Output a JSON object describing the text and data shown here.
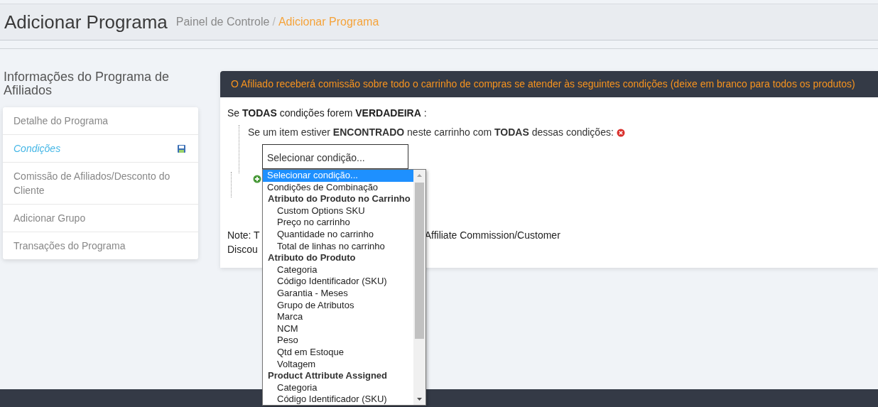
{
  "header": {
    "title": "Adicionar Programa",
    "breadcrumb_separator": "/",
    "breadcrumb": [
      {
        "label": "Painel de Controle",
        "selected": false
      },
      {
        "label": "Adicionar Programa",
        "selected": true
      }
    ]
  },
  "sidebar": {
    "title": "Informações do Programa de Afiliados",
    "items": [
      {
        "label": "Detalhe do Programa",
        "selected": false,
        "save_icon": false
      },
      {
        "label": "Condições",
        "selected": true,
        "save_icon": true
      },
      {
        "label": "Comissão de Afiliados/Desconto do Cliente",
        "selected": false,
        "save_icon": false
      },
      {
        "label": "Adicionar Grupo",
        "selected": false,
        "save_icon": false
      },
      {
        "label": "Transações do Programa",
        "selected": false,
        "save_icon": false
      }
    ]
  },
  "panel": {
    "heading": "O Afiliado receberá comissão sobre todo o carrinho de compras se atender às seguintes condições (deixe em branco para todos os produtos)",
    "rule": "Se **TODAS**  condições forem **VERDADEIRA** :",
    "subrule": "Se um item estiver **ENCONTRADO**  neste carrinho com **TODAS**  dessas condições:",
    "select": {
      "value": "Selecionar condição...",
      "options": [
        {
          "kind": "option",
          "label": "Selecionar condição...",
          "selected": true
        },
        {
          "kind": "option",
          "label": "Condições de Combinação",
          "selected": false
        },
        {
          "kind": "group",
          "label": "Atributo do Produto no Carrinho",
          "children": [
            {
              "kind": "option",
              "label": "Custom Options SKU",
              "selected": false
            },
            {
              "kind": "option",
              "label": "Preço no carrinho",
              "selected": false
            },
            {
              "kind": "option",
              "label": "Quantidade no carrinho",
              "selected": false
            },
            {
              "kind": "option",
              "label": "Total de linhas no carrinho",
              "selected": false
            }
          ]
        },
        {
          "kind": "group",
          "label": "Atributo do Produto",
          "children": [
            {
              "kind": "option",
              "label": "Categoria",
              "selected": false
            },
            {
              "kind": "option",
              "label": "Código Identificador (SKU)",
              "selected": false
            },
            {
              "kind": "option",
              "label": "Garantia - Meses",
              "selected": false
            },
            {
              "kind": "option",
              "label": "Grupo de Atributos",
              "selected": false
            },
            {
              "kind": "option",
              "label": "Marca",
              "selected": false
            },
            {
              "kind": "option",
              "label": "NCM",
              "selected": false
            },
            {
              "kind": "option",
              "label": "Peso",
              "selected": false
            },
            {
              "kind": "option",
              "label": "Qtd em Estoque",
              "selected": false
            },
            {
              "kind": "option",
              "label": "Voltagem",
              "selected": false
            }
          ]
        },
        {
          "kind": "group",
          "label": "Product Attribute Assigned",
          "children": [
            {
              "kind": "option",
              "label": "Categoria",
              "selected": false
            },
            {
              "kind": "option",
              "label": "Código Identificador (SKU)",
              "selected": false
            }
          ]
        }
      ]
    },
    "note": {
      "line_1_start": "Note: T",
      "line_1_end": "Affiliate Commission/Customer",
      "line_2_start": "Discou"
    }
  }
}
